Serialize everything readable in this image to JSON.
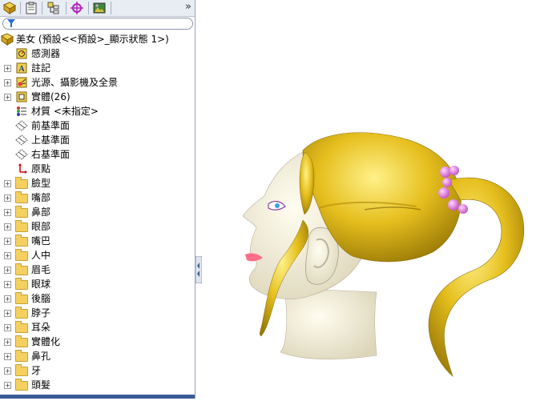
{
  "toolbar": {
    "buttons": [
      {
        "name": "feature-manager-icon"
      },
      {
        "name": "property-manager-icon"
      },
      {
        "name": "configuration-manager-icon"
      },
      {
        "name": "dimxpert-icon"
      },
      {
        "name": "display-manager-icon"
      }
    ],
    "more": "»"
  },
  "tree": {
    "root": "美女  (預設<<預設>_顯示狀態 1>)",
    "items": [
      {
        "label": "感測器",
        "icon": "sensor-icon",
        "expand": false
      },
      {
        "label": "註記",
        "icon": "annotation-icon",
        "expand": true
      },
      {
        "label": "光源、攝影機及全景",
        "icon": "lights-icon",
        "expand": true
      },
      {
        "label": "實體(26)",
        "icon": "solid-bodies-icon",
        "expand": true
      },
      {
        "label": "材質 <未指定>",
        "icon": "material-icon",
        "expand": false
      },
      {
        "label": "前基準面",
        "icon": "plane-icon",
        "expand": false
      },
      {
        "label": "上基準面",
        "icon": "plane-icon",
        "expand": false
      },
      {
        "label": "右基準面",
        "icon": "plane-icon",
        "expand": false
      },
      {
        "label": "原點",
        "icon": "origin-icon",
        "expand": false
      },
      {
        "label": "臉型",
        "icon": "folder-icon",
        "expand": true
      },
      {
        "label": "嘴部",
        "icon": "folder-icon",
        "expand": true
      },
      {
        "label": "鼻部",
        "icon": "folder-icon",
        "expand": true
      },
      {
        "label": "眼部",
        "icon": "folder-icon",
        "expand": true
      },
      {
        "label": "嘴巴",
        "icon": "folder-icon",
        "expand": true
      },
      {
        "label": "人中",
        "icon": "folder-icon",
        "expand": true
      },
      {
        "label": "眉毛",
        "icon": "folder-icon",
        "expand": true
      },
      {
        "label": "眼球",
        "icon": "folder-icon",
        "expand": true
      },
      {
        "label": "後腦",
        "icon": "folder-icon",
        "expand": true
      },
      {
        "label": "脖子",
        "icon": "folder-icon",
        "expand": true
      },
      {
        "label": "耳朵",
        "icon": "folder-icon",
        "expand": true
      },
      {
        "label": "實體化",
        "icon": "folder-icon",
        "expand": true
      },
      {
        "label": "鼻孔",
        "icon": "folder-icon",
        "expand": true
      },
      {
        "label": "牙",
        "icon": "folder-icon",
        "expand": true
      },
      {
        "label": "頭髮",
        "icon": "folder-icon",
        "expand": true
      }
    ]
  },
  "colors": {
    "hair": "#e6bf1e",
    "skin": "#f3efd9",
    "hair_tie": "#e97be6",
    "panel_bg": "#e8ecf3",
    "accent": "#3c5a96"
  }
}
